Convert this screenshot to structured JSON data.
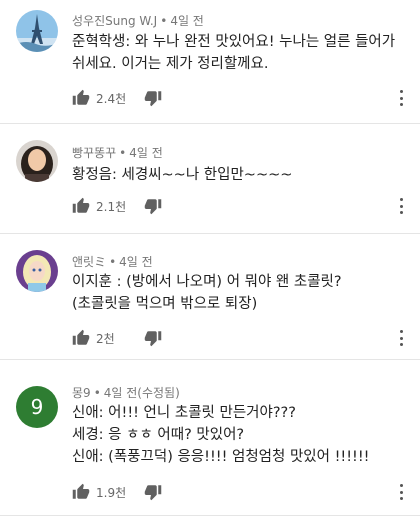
{
  "comments": [
    {
      "author": "성우진Sung W.J",
      "time": "4일 전",
      "lines": [
        "준혁학생: 와 누나 완전 맛있어요! 누나는 얼른 들어가",
        "쉬세요. 이거는 제가 정리할께요."
      ],
      "likes": "2.4천",
      "avatar_icon": "eiffel-tower-avatar-icon"
    },
    {
      "author": "빵꾸똥꾸",
      "time": "4일 전",
      "lines": [
        "황정음: 세경씨~~나 한입만~~~~"
      ],
      "likes": "2.1천",
      "avatar_icon": "girl-photo-avatar-icon"
    },
    {
      "author": "앤릿ミ",
      "time": "4일 전",
      "lines": [
        "이지훈 : (방에서 나오며) 어 뭐야 왠 초콜릿?",
        "(초콜릿을 먹으며 밖으로 퇴장)"
      ],
      "likes": "2천",
      "avatar_icon": "elsa-cartoon-avatar-icon"
    },
    {
      "author": "몽9",
      "time": "4일 전(수정됨)",
      "lines": [
        "신애: 어!!! 언니 초콜릿 만든거야???",
        "세경: 응 ㅎㅎ 어때? 맛있어?",
        "신애: (폭풍끄덕) 응응!!!! 엄청엄청 맛있어 !!!!!!"
      ],
      "likes": "1.9천",
      "avatar_letter": "9",
      "avatar_color": "#2e7d32"
    }
  ],
  "dot": "•",
  "colors": {
    "meta": "#777777",
    "icon": "#606060",
    "divider": "#e5e5e5"
  }
}
